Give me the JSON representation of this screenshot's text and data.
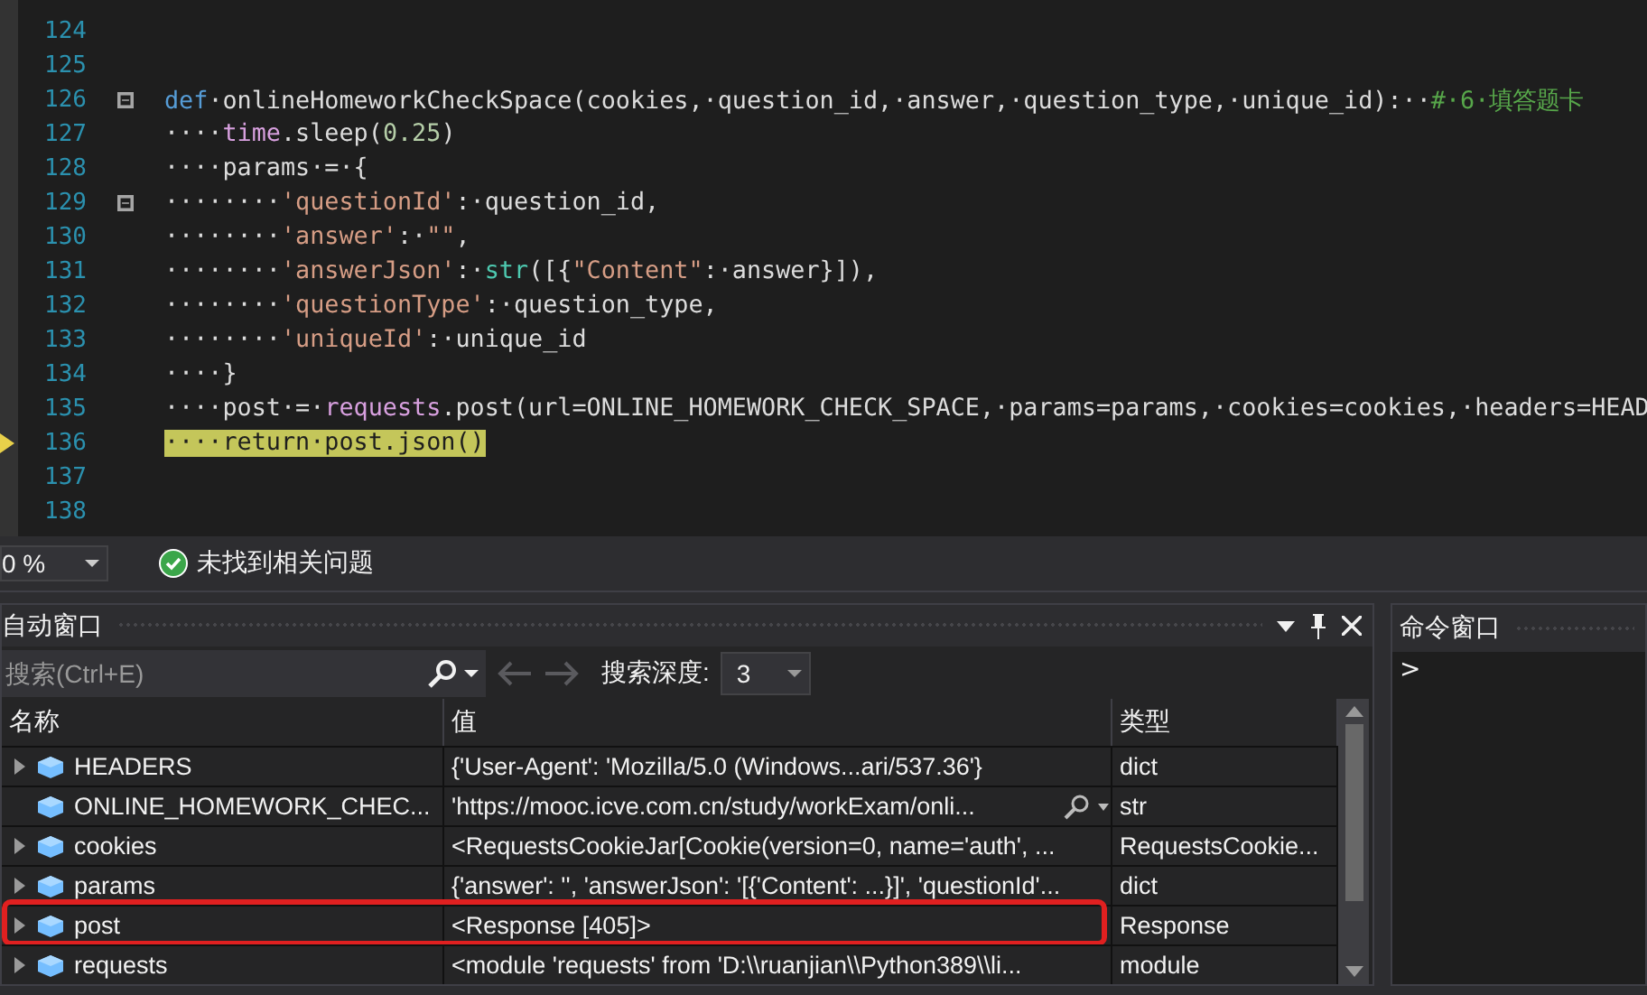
{
  "editor": {
    "lines": [
      {
        "number": "124",
        "fold": false,
        "current": false
      },
      {
        "number": "125",
        "fold": false,
        "current": false
      },
      {
        "number": "126",
        "fold": true,
        "current": false,
        "tokens": [
          {
            "kind": "keyword",
            "text": "def"
          },
          {
            "kind": "plain",
            "text": "·onlineHomeworkCheckSpace(cookies,·question_id,·answer,·question_type,·unique_id):··"
          },
          {
            "kind": "comment",
            "text": "#·6·填答题卡"
          }
        ]
      },
      {
        "number": "127",
        "fold": false,
        "current": false,
        "tokens": [
          {
            "kind": "plain",
            "text": "····"
          },
          {
            "kind": "module",
            "text": "time"
          },
          {
            "kind": "plain",
            "text": ".sleep("
          },
          {
            "kind": "number",
            "text": "0.25"
          },
          {
            "kind": "plain",
            "text": ")"
          }
        ]
      },
      {
        "number": "128",
        "fold": false,
        "current": false,
        "tokens": [
          {
            "kind": "plain",
            "text": "····params·=·{"
          }
        ]
      },
      {
        "number": "129",
        "fold": true,
        "current": false,
        "tokens": [
          {
            "kind": "plain",
            "text": "········"
          },
          {
            "kind": "string",
            "text": "'questionId'"
          },
          {
            "kind": "plain",
            "text": ":·question_id,"
          }
        ]
      },
      {
        "number": "130",
        "fold": false,
        "current": false,
        "tokens": [
          {
            "kind": "plain",
            "text": "········"
          },
          {
            "kind": "string",
            "text": "'answer'"
          },
          {
            "kind": "plain",
            "text": ":·"
          },
          {
            "kind": "string",
            "text": "\"\""
          },
          {
            "kind": "plain",
            "text": ","
          }
        ]
      },
      {
        "number": "131",
        "fold": false,
        "current": false,
        "tokens": [
          {
            "kind": "plain",
            "text": "········"
          },
          {
            "kind": "string",
            "text": "'answerJson'"
          },
          {
            "kind": "plain",
            "text": ":·"
          },
          {
            "kind": "builtin",
            "text": "str"
          },
          {
            "kind": "plain",
            "text": "([{"
          },
          {
            "kind": "string",
            "text": "\"Content\""
          },
          {
            "kind": "plain",
            "text": ":·answer}]),"
          }
        ]
      },
      {
        "number": "132",
        "fold": false,
        "current": false,
        "tokens": [
          {
            "kind": "plain",
            "text": "········"
          },
          {
            "kind": "string",
            "text": "'questionType'"
          },
          {
            "kind": "plain",
            "text": ":·question_type,"
          }
        ]
      },
      {
        "number": "133",
        "fold": false,
        "current": false,
        "tokens": [
          {
            "kind": "plain",
            "text": "········"
          },
          {
            "kind": "string",
            "text": "'uniqueId'"
          },
          {
            "kind": "plain",
            "text": ":·unique_id"
          }
        ]
      },
      {
        "number": "134",
        "fold": false,
        "current": false,
        "tokens": [
          {
            "kind": "plain",
            "text": "····}"
          }
        ]
      },
      {
        "number": "135",
        "fold": false,
        "current": false,
        "tokens": [
          {
            "kind": "plain",
            "text": "····post·=·"
          },
          {
            "kind": "module",
            "text": "requests"
          },
          {
            "kind": "plain",
            "text": ".post(url=ONLINE_HOMEWORK_CHECK_SPACE,·params=params,·cookies=cookies,·headers=HEAD"
          }
        ]
      },
      {
        "number": "136",
        "fold": false,
        "current": true,
        "tokens": [
          {
            "kind": "plain",
            "text": "····return·post.json()"
          }
        ]
      },
      {
        "number": "137",
        "fold": false,
        "current": false
      },
      {
        "number": "138",
        "fold": false,
        "current": false
      }
    ]
  },
  "status_bar": {
    "zoom": "0 %",
    "issues": "未找到相关问题"
  },
  "autos_window": {
    "title": "自动窗口",
    "search": {
      "placeholder": "搜索(Ctrl+E)"
    },
    "depth_label": "搜索深度:",
    "depth_value": "3",
    "columns": [
      "名称",
      "值",
      "类型"
    ],
    "rows": [
      {
        "name": "HEADERS",
        "value": "{'User-Agent': 'Mozilla/5.0 (Windows...ari/537.36'}",
        "type": "dict",
        "expandable": true,
        "annotated": false,
        "value_tools": false
      },
      {
        "name": "ONLINE_HOMEWORK_CHEC...",
        "value": "'https://mooc.icve.com.cn/study/workExam/onli...",
        "type": "str",
        "expandable": false,
        "annotated": false,
        "value_tools": true
      },
      {
        "name": "cookies",
        "value": "<RequestsCookieJar[Cookie(version=0, name='auth', ...",
        "type": "RequestsCookie...",
        "expandable": true,
        "annotated": false,
        "value_tools": false
      },
      {
        "name": "params",
        "value": "{'answer': '', 'answerJson': '[{'Content': ...}]', 'questionId'...",
        "type": "dict",
        "expandable": true,
        "annotated": false,
        "value_tools": false
      },
      {
        "name": "post",
        "value": "<Response [405]>",
        "type": "Response",
        "expandable": true,
        "annotated": true,
        "value_tools": false
      },
      {
        "name": "requests",
        "value": "<module 'requests' from 'D:\\\\ruanjian\\\\Python389\\\\li...",
        "type": "module",
        "expandable": true,
        "annotated": false,
        "value_tools": false
      }
    ]
  },
  "command_window": {
    "title": "命令窗口",
    "prompt": ">"
  }
}
